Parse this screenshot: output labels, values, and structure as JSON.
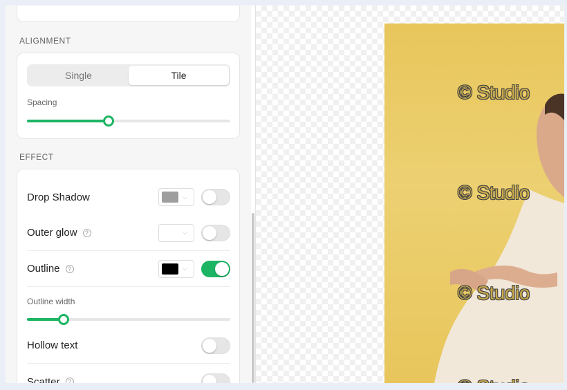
{
  "alignment": {
    "title": "ALIGNMENT",
    "options": [
      "Single",
      "Tile"
    ],
    "selected": "Tile",
    "spacing_label": "Spacing",
    "spacing_value": 0.4
  },
  "effect": {
    "title": "EFFECT",
    "drop_shadow": {
      "label": "Drop Shadow",
      "color": "#9e9e9e",
      "enabled": false
    },
    "outer_glow": {
      "label": "Outer glow",
      "color": "#ffffff",
      "enabled": false
    },
    "outline": {
      "label": "Outline",
      "color": "#000000",
      "enabled": true
    },
    "outline_width_label": "Outline width",
    "outline_width_value": 0.18,
    "hollow_text": {
      "label": "Hollow text",
      "enabled": false
    },
    "scatter": {
      "label": "Scatter",
      "enabled": false
    }
  },
  "preview": {
    "watermark_text": "© Studio",
    "background_color": "#e8c65c"
  }
}
